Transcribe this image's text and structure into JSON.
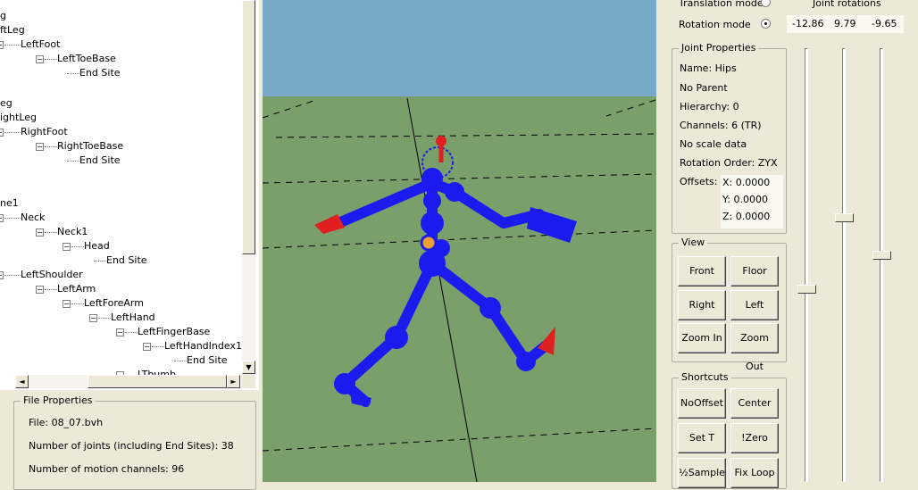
{
  "tree": {
    "items": [
      {
        "text": "g"
      },
      {
        "text": "ftLeg"
      },
      {
        "text": "LeftFoot"
      },
      {
        "text": "LeftToeBase"
      },
      {
        "text": "End Site"
      },
      {
        "text": "eg"
      },
      {
        "text": "ightLeg"
      },
      {
        "text": "RightFoot"
      },
      {
        "text": "RightToeBase"
      },
      {
        "text": "End Site"
      },
      {
        "text": "ne1"
      },
      {
        "text": "Neck"
      },
      {
        "text": "Neck1"
      },
      {
        "text": "Head"
      },
      {
        "text": "End Site"
      },
      {
        "text": "LeftShoulder"
      },
      {
        "text": "LeftArm"
      },
      {
        "text": "LeftForeArm"
      },
      {
        "text": "LeftHand"
      },
      {
        "text": "LeftFingerBase"
      },
      {
        "text": "LeftHandIndex1"
      },
      {
        "text": "End Site"
      },
      {
        "text": "LThumb"
      }
    ]
  },
  "file_properties": {
    "title": "File Properties",
    "file": "File: 08_07.bvh",
    "joints": "Number of joints (including End Sites): 38",
    "channels": "Number of motion channels: 96"
  },
  "mode": {
    "translation_label": "Translation mode",
    "rotation_label": "Rotation mode",
    "selected": "rotation"
  },
  "joint_rotations": {
    "title": "Joint rotations",
    "values": [
      "-12.86",
      "9.79",
      "-9.65"
    ],
    "slider_levels": [
      0.55,
      0.38,
      0.47
    ]
  },
  "joint_properties": {
    "title": "Joint Properties",
    "name": "Name: Hips",
    "parent": "No Parent",
    "hierarchy": "Hierarchy: 0",
    "channels": "Channels: 6 (TR)",
    "scale": "No scale data",
    "rotation_order": "Rotation Order: ZYX",
    "offsets_label": "Offsets:",
    "offsets": [
      "X:  0.0000",
      "Y:  0.0000",
      "Z:  0.0000"
    ]
  },
  "view": {
    "title": "View",
    "buttons": [
      "Front",
      "Floor",
      "Right",
      "Left",
      "Zoom In",
      "Zoom Out"
    ]
  },
  "shortcuts": {
    "title": "Shortcuts",
    "buttons": [
      "NoOffset",
      "Center",
      "Set T",
      "!Zero",
      "½Sample",
      "Fix Loop"
    ]
  },
  "colors": {
    "sky": "#77a8c9",
    "floor": "#7a9f6a",
    "skeleton": "#1b1bf0",
    "selected_joint": "#e02020"
  }
}
